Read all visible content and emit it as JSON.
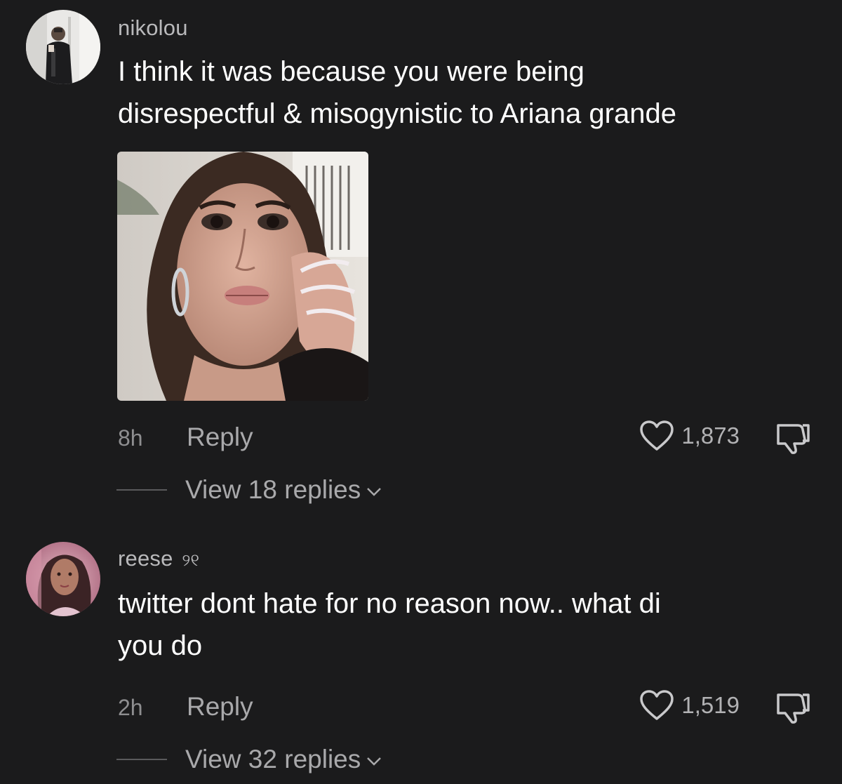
{
  "comments": [
    {
      "username": "nikolou",
      "text_lines": [
        "I think it was because you were being",
        "disrespectful & misogynistic to Ariana grande"
      ],
      "time": "8h",
      "reply_label": "Reply",
      "likes": "1,873",
      "view_replies": "View 18 replies"
    },
    {
      "username": "reese",
      "username_glyph": "୨୧",
      "text_lines": [
        "twitter dont hate for no reason now.. what di",
        "you do"
      ],
      "time": "2h",
      "reply_label": "Reply",
      "likes": "1,519",
      "view_replies": "View 32 replies"
    }
  ]
}
